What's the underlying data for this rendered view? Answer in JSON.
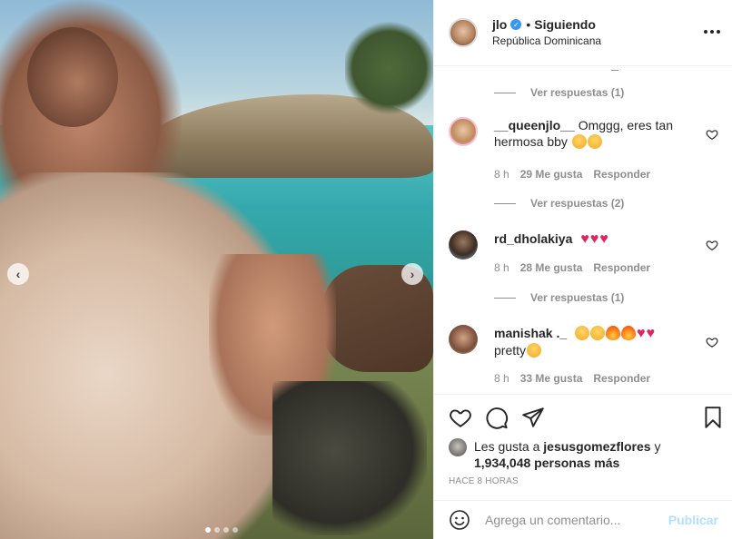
{
  "post": {
    "username": "jlo",
    "verified_mark": "✓",
    "separator": "•",
    "follow_status": "Siguiendo",
    "location": "República Dominicana",
    "more_icon": "more-horizontal-icon"
  },
  "media": {
    "prev_icon": "‹",
    "next_icon": "›",
    "slide_count": 4,
    "active_slide": 1
  },
  "comments": [
    {
      "replies_label": "Ver respuestas (1)"
    },
    {
      "username": "__queenjlo__",
      "text": "Omggg, eres tan hermosa bby",
      "time": "8 h",
      "likes": "29 Me gusta",
      "reply": "Responder",
      "replies_label": "Ver respuestas (2)"
    },
    {
      "username": "rd_dholakiya",
      "text": "",
      "time": "8 h",
      "likes": "28 Me gusta",
      "reply": "Responder",
      "replies_label": "Ver respuestas (1)"
    },
    {
      "username": "manishak ._",
      "text": "pretty",
      "time": "8 h",
      "likes": "33 Me gusta",
      "reply": "Responder"
    }
  ],
  "likes": {
    "prefix": "Les gusta a",
    "user": "jesusgomezflores",
    "conj": "y",
    "count": "1,934,048 personas más"
  },
  "timestamp": "HACE 8 HORAS",
  "composer": {
    "placeholder": "Agrega un comentario...",
    "publish": "Publicar"
  },
  "colors": {
    "heart": "#e0245e",
    "link_disabled": "#b2dffc",
    "muted": "#8e8e8e",
    "verified": "#3897f0"
  }
}
